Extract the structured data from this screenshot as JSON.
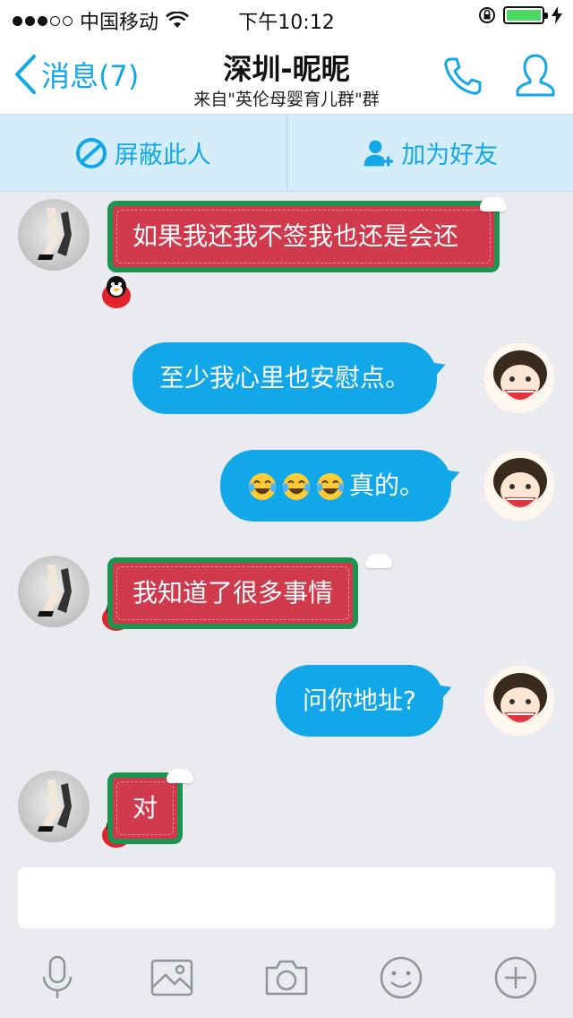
{
  "status_bar": {
    "carrier": "中国移动",
    "time": "下午10:12",
    "battery_color": "#4cd964"
  },
  "nav": {
    "back_label": "消息(7)",
    "title": "深圳-昵昵",
    "subtitle": "来自\"英伦母婴育儿群\"群",
    "accent_color": "#12a7e8",
    "call_icon": "phone-icon",
    "profile_icon": "person-icon"
  },
  "actions": {
    "block_label": "屏蔽此人",
    "add_friend_label": "加为好友"
  },
  "messages": [
    {
      "side": "left",
      "text": "如果我还我不签我也还是会还"
    },
    {
      "side": "right",
      "text": "至少我心里也安慰点。"
    },
    {
      "side": "right",
      "text": "真的。",
      "emoji_count": 3,
      "emoji": "laughing-crying-emoji"
    },
    {
      "side": "left",
      "text": "我知道了很多事情"
    },
    {
      "side": "right",
      "text": "问你地址?"
    },
    {
      "side": "left",
      "text": "对"
    }
  ],
  "input": {
    "placeholder": ""
  },
  "toolbar": {
    "items": [
      "microphone-icon",
      "image-icon",
      "camera-icon",
      "smiley-icon",
      "plus-icon"
    ]
  }
}
